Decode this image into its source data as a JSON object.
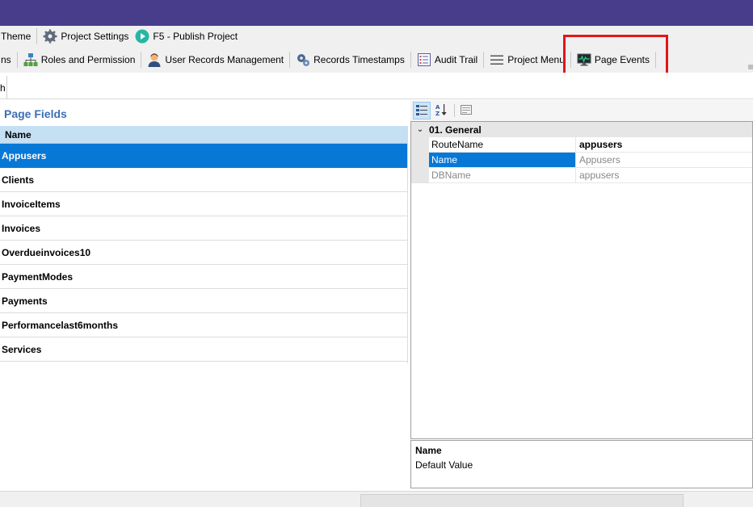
{
  "toolbar1": {
    "theme_label": "Theme",
    "project_settings_label": "Project Settings",
    "publish_label": "F5 - Publish Project"
  },
  "toolbar2": {
    "partial_label": "ns",
    "roles_label": "Roles and Permission",
    "user_records_label": "User Records Management",
    "timestamps_label": "Records Timestamps",
    "audit_label": "Audit Trail",
    "menu_label": "Project Menu",
    "page_events_label": "Page Events"
  },
  "tab": {
    "partial_label": "h"
  },
  "page_fields": {
    "title": "Page Fields",
    "column_header": "Name",
    "rows": [
      {
        "name": "Appusers",
        "selected": true
      },
      {
        "name": "Clients"
      },
      {
        "name": "InvoiceItems"
      },
      {
        "name": "Invoices"
      },
      {
        "name": "Overdueinvoices10"
      },
      {
        "name": "PaymentModes"
      },
      {
        "name": "Payments"
      },
      {
        "name": "Performancelast6months"
      },
      {
        "name": "Services"
      }
    ]
  },
  "properties": {
    "category": "01. General",
    "rows": [
      {
        "name": "RouteName",
        "value": "appusers"
      },
      {
        "name": "Name",
        "value": "Appusers"
      },
      {
        "name": "DBName",
        "value": "appusers"
      }
    ]
  },
  "description": {
    "title": "Name",
    "text": "Default Value"
  },
  "colors": {
    "titlebar": "#483d8b",
    "selection": "#0878d7",
    "highlight_box": "#e3151a",
    "pane_title": "#3b6fb6"
  }
}
